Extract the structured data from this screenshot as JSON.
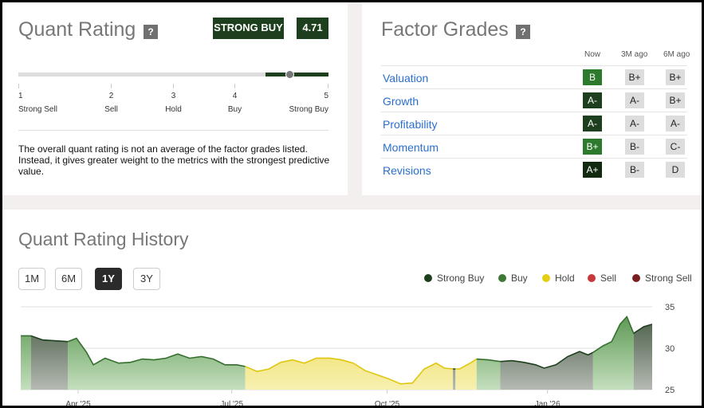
{
  "quant_rating": {
    "title": "Quant Rating",
    "help": "?",
    "rating_label": "STRONG BUY",
    "score": "4.71",
    "score_value": 4.71,
    "scale": [
      {
        "num": "1",
        "label": "Strong Sell"
      },
      {
        "num": "2",
        "label": "Sell"
      },
      {
        "num": "3",
        "label": "Hold"
      },
      {
        "num": "4",
        "label": "Buy"
      },
      {
        "num": "5",
        "label": "Strong Buy"
      }
    ],
    "description": "The overall quant rating is not an average of the factor grades listed. Instead, it gives greater weight to the metrics with the strongest predictive value."
  },
  "factor_grades": {
    "title": "Factor Grades",
    "help": "?",
    "columns": [
      "Now",
      "3M ago",
      "6M ago"
    ],
    "rows": [
      {
        "name": "Valuation",
        "now": "B",
        "m3": "B+",
        "m6": "B+",
        "now_color": "#2e7a2c"
      },
      {
        "name": "Growth",
        "now": "A-",
        "m3": "A-",
        "m6": "B+",
        "now_color": "#1e3f1d"
      },
      {
        "name": "Profitability",
        "now": "A-",
        "m3": "A-",
        "m6": "A-",
        "now_color": "#1e3f1d"
      },
      {
        "name": "Momentum",
        "now": "B+",
        "m3": "B-",
        "m6": "C-",
        "now_color": "#2e7a2c"
      },
      {
        "name": "Revisions",
        "now": "A+",
        "m3": "B-",
        "m6": "D",
        "now_color": "#10290f"
      }
    ]
  },
  "history": {
    "title": "Quant Rating History",
    "ranges": [
      "1M",
      "6M",
      "1Y",
      "3Y"
    ],
    "active_range": "1Y",
    "legend": [
      {
        "label": "Strong Buy",
        "color": "#1e3f1d"
      },
      {
        "label": "Buy",
        "color": "#3c7a34"
      },
      {
        "label": "Hold",
        "color": "#e5cf14"
      },
      {
        "label": "Sell",
        "color": "#c8383a"
      },
      {
        "label": "Strong Sell",
        "color": "#7a1f1f"
      }
    ]
  },
  "chart_data": {
    "type": "area",
    "title": "Quant Rating History",
    "xlabel": "",
    "ylabel": "",
    "ylim": [
      25,
      35
    ],
    "yticks": [
      "35",
      "30",
      "25"
    ],
    "xlim": [
      0,
      374
    ],
    "xticks": [
      {
        "day": 34,
        "label": "Apr '25"
      },
      {
        "day": 125,
        "label": "Jul '25"
      },
      {
        "day": 217,
        "label": "Oct '25"
      },
      {
        "day": 312,
        "label": "Jan '26"
      }
    ],
    "x": [
      0,
      6,
      13,
      28,
      33,
      39,
      43,
      50,
      58,
      65,
      72,
      79,
      86,
      93,
      100,
      107,
      114,
      121,
      128,
      133,
      140,
      147,
      154,
      161,
      168,
      175,
      183,
      190,
      197,
      204,
      211,
      218,
      225,
      232,
      239,
      246,
      251,
      256,
      260,
      267,
      270,
      277,
      284,
      291,
      298,
      305,
      310,
      317,
      324,
      331,
      336,
      339,
      345,
      350,
      355,
      359,
      363,
      369,
      374
    ],
    "y": [
      31.5,
      31.5,
      31.0,
      30.8,
      31.2,
      29.5,
      28.0,
      28.8,
      28.2,
      28.3,
      28.7,
      28.6,
      28.8,
      29.3,
      28.8,
      29.0,
      28.7,
      28.0,
      28.0,
      27.8,
      27.2,
      27.5,
      28.3,
      28.6,
      28.2,
      28.8,
      28.8,
      28.6,
      28.2,
      27.3,
      26.8,
      26.3,
      25.7,
      25.8,
      27.5,
      28.2,
      27.6,
      27.5,
      27.5,
      28.3,
      28.7,
      28.6,
      28.4,
      28.5,
      28.3,
      28.0,
      27.6,
      28.0,
      29.0,
      29.6,
      29.2,
      29.5,
      30.3,
      30.8,
      32.9,
      33.8,
      31.8,
      32.6,
      32.9
    ],
    "rating_bands": [
      {
        "from": 0,
        "to": 6,
        "rating": "Buy"
      },
      {
        "from": 6,
        "to": 28,
        "rating": "Strong Buy"
      },
      {
        "from": 28,
        "to": 133,
        "rating": "Buy"
      },
      {
        "from": 133,
        "to": 256,
        "rating": "Hold"
      },
      {
        "from": 256,
        "to": 257.5,
        "rating": "Strong Buy"
      },
      {
        "from": 257.5,
        "to": 270,
        "rating": "Hold"
      },
      {
        "from": 270,
        "to": 284,
        "rating": "Buy"
      },
      {
        "from": 284,
        "to": 339,
        "rating": "Strong Buy"
      },
      {
        "from": 339,
        "to": 363,
        "rating": "Buy"
      },
      {
        "from": 363,
        "to": 374,
        "rating": "Strong Buy"
      }
    ]
  }
}
